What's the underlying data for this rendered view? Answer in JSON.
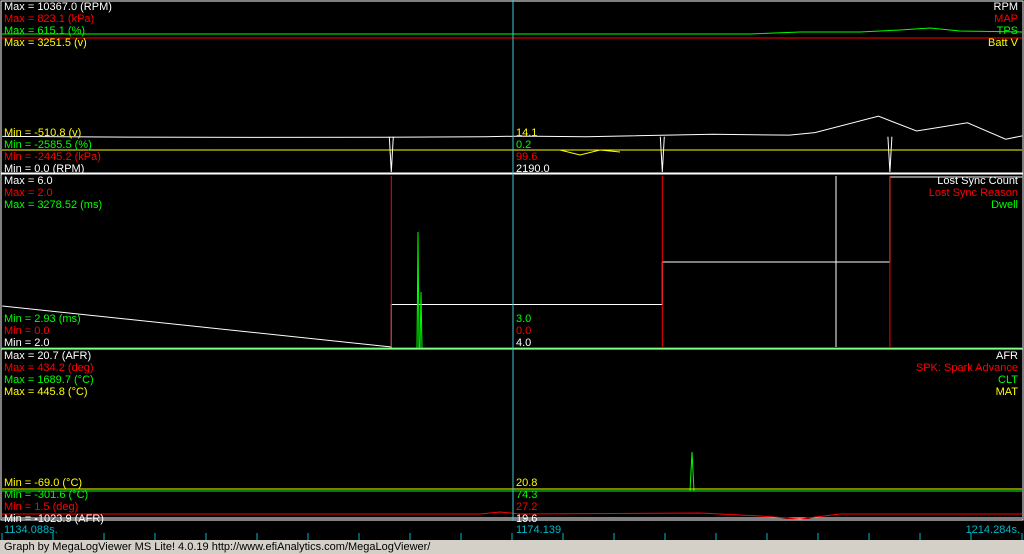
{
  "colors": {
    "white": "#ffffff",
    "red": "#ff0000",
    "green": "#00ff00",
    "yellow": "#ffff00",
    "cursor": "#40c8d8",
    "timeline": "#00b8c8"
  },
  "panel1": {
    "max": [
      {
        "text": "Max = 10367.0 (RPM)",
        "color": "white"
      },
      {
        "text": "Max = 823.1 (kPa)",
        "color": "red"
      },
      {
        "text": "Max = 615.1 (%)",
        "color": "green"
      },
      {
        "text": "Max = 3251.5 (v)",
        "color": "yellow"
      }
    ],
    "min": [
      {
        "text": "Min = -510.8 (v)",
        "color": "yellow"
      },
      {
        "text": "Min = -2585.5 (%)",
        "color": "green"
      },
      {
        "text": "Min = -2445.2 (kPa)",
        "color": "red"
      },
      {
        "text": "Min = 0.0 (RPM)",
        "color": "white"
      }
    ],
    "legend": [
      {
        "text": "RPM",
        "color": "white"
      },
      {
        "text": "MAP",
        "color": "red"
      },
      {
        "text": "TPS",
        "color": "green"
      },
      {
        "text": "Batt V",
        "color": "yellow"
      }
    ],
    "cursor_values": [
      {
        "text": "14.1",
        "color": "yellow"
      },
      {
        "text": "0.2",
        "color": "green"
      },
      {
        "text": "99.6",
        "color": "red"
      },
      {
        "text": "2190.0",
        "color": "white"
      }
    ]
  },
  "panel2": {
    "max": [
      {
        "text": "Max = 6.0",
        "color": "white"
      },
      {
        "text": "Max = 2.0",
        "color": "red"
      },
      {
        "text": "Max = 3278.52 (ms)",
        "color": "green"
      }
    ],
    "min": [
      {
        "text": "Min = 2.93 (ms)",
        "color": "green"
      },
      {
        "text": "Min = 0.0",
        "color": "red"
      },
      {
        "text": "Min = 2.0",
        "color": "white"
      }
    ],
    "legend": [
      {
        "text": "Lost Sync Count",
        "color": "white"
      },
      {
        "text": "Lost Sync Reason",
        "color": "red"
      },
      {
        "text": "Dwell",
        "color": "green"
      }
    ],
    "cursor_values": [
      {
        "text": "3.0",
        "color": "green"
      },
      {
        "text": "0.0",
        "color": "red"
      },
      {
        "text": "4.0",
        "color": "white"
      }
    ]
  },
  "panel3": {
    "max": [
      {
        "text": "Max = 20.7 (AFR)",
        "color": "white"
      },
      {
        "text": "Max = 434.2 (deg)",
        "color": "red"
      },
      {
        "text": "Max = 1689.7 (°C)",
        "color": "green"
      },
      {
        "text": "Max = 445.8 (°C)",
        "color": "yellow"
      }
    ],
    "min": [
      {
        "text": "Min = -69.0 (°C)",
        "color": "yellow"
      },
      {
        "text": "Min = -301.6 (°C)",
        "color": "green"
      },
      {
        "text": "Min = 1.5 (deg)",
        "color": "red"
      },
      {
        "text": "Min = -1023.9 (AFR)",
        "color": "white"
      }
    ],
    "legend": [
      {
        "text": "AFR",
        "color": "white"
      },
      {
        "text": "SPK: Spark Advance",
        "color": "red"
      },
      {
        "text": "CLT",
        "color": "green"
      },
      {
        "text": "MAT",
        "color": "yellow"
      }
    ],
    "cursor_values": [
      {
        "text": "20.8",
        "color": "yellow"
      },
      {
        "text": "74.3",
        "color": "green"
      },
      {
        "text": "27.2",
        "color": "red"
      },
      {
        "text": "19.6",
        "color": "white"
      }
    ]
  },
  "timeline": {
    "start": "1134.088s.",
    "cursor": "1174.139",
    "end": "1214.284s."
  },
  "footer": "Graph by MegaLogViewer MS Lite! 4.0.19 http://www.efiAnalytics.com/MegaLogViewer/",
  "chart_data": [
    {
      "type": "line",
      "xlim": [
        1134.088,
        1214.284
      ],
      "series": [
        {
          "name": "RPM",
          "color": "white",
          "cursor_value": 2190.0,
          "x": [
            1134.1,
            1144,
            1154,
            1164,
            1172,
            1175,
            1180,
            1190,
            1196,
            1198,
            1203,
            1206,
            1210,
            1213,
            1214.3
          ],
          "y": [
            2170,
            2130,
            2110,
            2120,
            2150,
            2190,
            2150,
            2300,
            2250,
            2400,
            3400,
            2500,
            3000,
            2000,
            2200
          ]
        },
        {
          "name": "MAP",
          "color": "red",
          "cursor_value": 99.6
        },
        {
          "name": "TPS",
          "color": "green",
          "cursor_value": 0.2
        },
        {
          "name": "Batt V",
          "color": "yellow",
          "cursor_value": 14.1
        }
      ]
    },
    {
      "type": "line",
      "xlim": [
        1134.088,
        1214.284
      ],
      "series": [
        {
          "name": "Lost Sync Count",
          "color": "white",
          "cursor_value": 4.0,
          "x": [
            1134.1,
            1164.7,
            1164.7,
            1186.0,
            1186.0,
            1203.9,
            1203.9,
            1214.3
          ],
          "y": [
            2,
            2,
            3,
            3,
            4,
            4,
            6,
            6
          ]
        },
        {
          "name": "Lost Sync Reason",
          "color": "red",
          "cursor_value": 0.0,
          "x": [
            1164.7,
            1186.0,
            1203.9
          ],
          "y": [
            2,
            2,
            2
          ]
        },
        {
          "name": "Dwell",
          "color": "green",
          "cursor_value": 3.0
        }
      ]
    },
    {
      "type": "line",
      "xlim": [
        1134.088,
        1214.284
      ],
      "series": [
        {
          "name": "AFR",
          "color": "white",
          "cursor_value": 19.6
        },
        {
          "name": "SPK: Spark Advance",
          "color": "red",
          "cursor_value": 27.2
        },
        {
          "name": "CLT",
          "color": "green",
          "cursor_value": 74.3
        },
        {
          "name": "MAT",
          "color": "yellow",
          "cursor_value": 20.8
        }
      ]
    }
  ]
}
